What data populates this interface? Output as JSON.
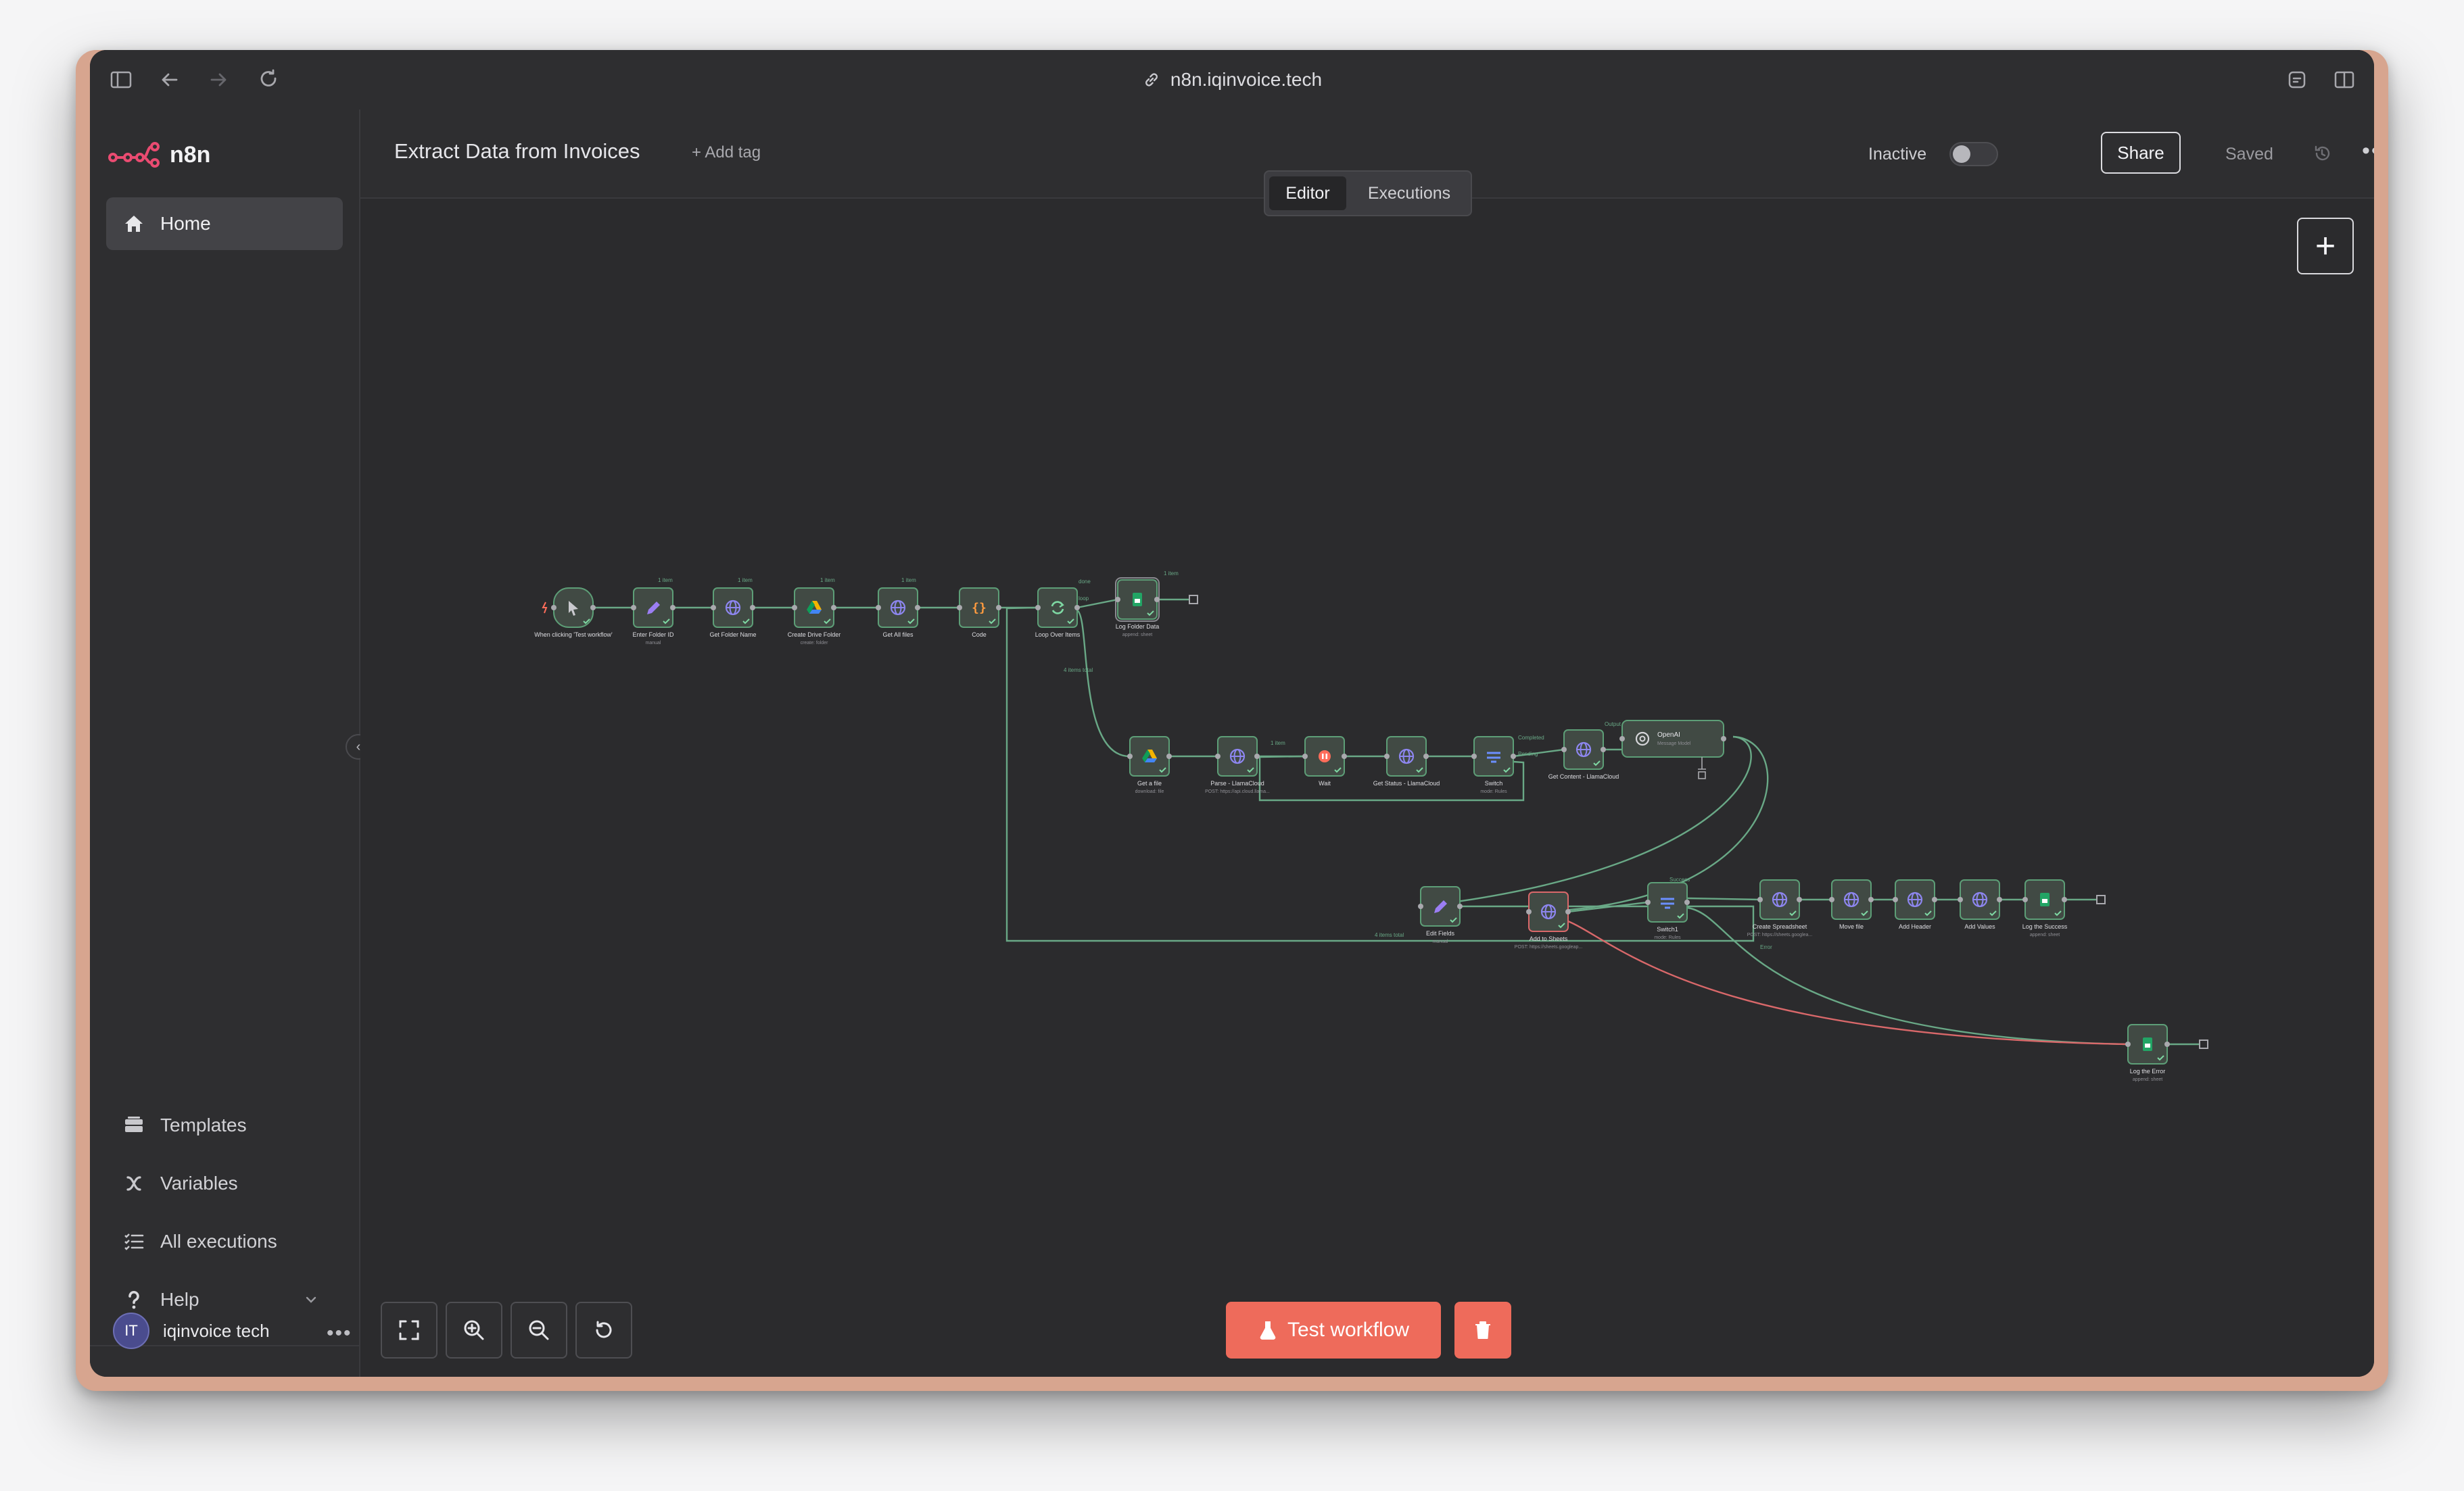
{
  "browser": {
    "url": "n8n.iqinvoice.tech"
  },
  "sidebar": {
    "logo_text": "n8n",
    "home_label": "Home",
    "templates_label": "Templates",
    "variables_label": "Variables",
    "executions_label": "All executions",
    "help_label": "Help",
    "user_initials": "IT",
    "user_name": "iqinvoice tech"
  },
  "header": {
    "workflow_title": "Extract Data from Invoices",
    "add_tag": "+ Add tag",
    "status_label": "Inactive",
    "share_label": "Share",
    "saved_label": "Saved"
  },
  "tabs": {
    "editor": "Editor",
    "executions": "Executions"
  },
  "canvas": {
    "test_button": "Test workflow"
  },
  "colors": {
    "accent": "#ee6b5b",
    "node_bg": "#414a44",
    "node_border": "#5d9e77",
    "connection": "#69a886",
    "error_connection": "#d9686a"
  },
  "nodes": [
    {
      "id": "trigger",
      "icon": "cursor-icon",
      "label": "When clicking 'Test workflow'",
      "sub": ""
    },
    {
      "id": "folder-id",
      "icon": "pencil-icon",
      "label": "Enter Folder ID",
      "sub": "manual"
    },
    {
      "id": "folder-name",
      "icon": "globe-icon",
      "label": "Get Folder Name",
      "sub": ""
    },
    {
      "id": "create-drive",
      "icon": "drive-icon",
      "label": "Create Drive Folder",
      "sub": "create: folder"
    },
    {
      "id": "all-files",
      "icon": "globe-icon",
      "label": "Get All files",
      "sub": ""
    },
    {
      "id": "code",
      "icon": "code-icon",
      "label": "Code",
      "sub": ""
    },
    {
      "id": "loop",
      "icon": "loop-icon",
      "label": "Loop Over Items",
      "sub": ""
    },
    {
      "id": "log-folder",
      "icon": "sheets-icon",
      "label": "Log Folder Data",
      "sub": "append: sheet"
    },
    {
      "id": "get-file",
      "icon": "drive-icon",
      "label": "Get a file",
      "sub": "download: file"
    },
    {
      "id": "parse",
      "icon": "globe-icon",
      "label": "Parse - LlamaCloud",
      "sub": "POST: https://api.cloud.llama..."
    },
    {
      "id": "wait",
      "icon": "pause-icon",
      "label": "Wait",
      "sub": ""
    },
    {
      "id": "status",
      "icon": "globe-icon",
      "label": "Get Status - LlamaCloud",
      "sub": ""
    },
    {
      "id": "switch",
      "icon": "switch-icon",
      "label": "Switch",
      "sub": "mode: Rules"
    },
    {
      "id": "content",
      "icon": "globe-icon",
      "label": "Get Content - LlamaCloud",
      "sub": ""
    },
    {
      "id": "openai",
      "icon": "openai-icon",
      "label": "OpenAI",
      "sub": "Message Model"
    },
    {
      "id": "edit-fields",
      "icon": "pencil-icon",
      "label": "Edit Fields",
      "sub": "manual"
    },
    {
      "id": "add-sheets",
      "icon": "globe-icon",
      "label": "Add to Sheets",
      "sub": "POST: https://sheets.googleap..."
    },
    {
      "id": "switch1",
      "icon": "switch-icon",
      "label": "Switch1",
      "sub": "mode: Rules"
    },
    {
      "id": "create-sheet",
      "icon": "globe-icon",
      "label": "Create Spreadsheet",
      "sub": "POST: https://sheets.googlea..."
    },
    {
      "id": "move-file",
      "icon": "globe-icon",
      "label": "Move file",
      "sub": ""
    },
    {
      "id": "add-header",
      "icon": "globe-icon",
      "label": "Add Header",
      "sub": ""
    },
    {
      "id": "add-values",
      "icon": "globe-icon",
      "label": "Add Values",
      "sub": ""
    },
    {
      "id": "log-success",
      "icon": "sheets-icon",
      "label": "Log the Success",
      "sub": "append: sheet"
    },
    {
      "id": "log-error",
      "icon": "sheets-icon",
      "label": "Log the Error",
      "sub": "append: sheet"
    }
  ],
  "edge_labels": {
    "one_item": "1 item",
    "done_branch": "done",
    "loop_branch": "loop",
    "items_total": "4 items total",
    "output": "Output",
    "completed": "Completed",
    "pending": "Pending",
    "success": "Success",
    "error": "Error"
  }
}
